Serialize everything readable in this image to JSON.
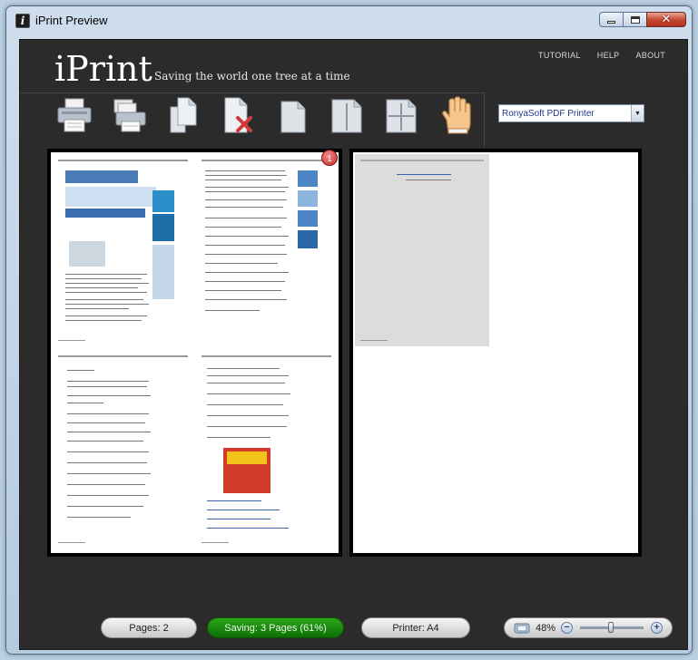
{
  "window": {
    "title": "iPrint Preview",
    "close_glyph": "✕"
  },
  "header": {
    "brand": "iPrint",
    "tagline": "Saving the world one tree at a time",
    "nav": [
      "TUTORIAL",
      "HELP",
      "ABOUT"
    ]
  },
  "toolbar": {
    "tools": [
      {
        "icon": "printer-icon"
      },
      {
        "icon": "print-multiple-icon"
      },
      {
        "icon": "copy-pages-icon"
      },
      {
        "icon": "delete-page-icon"
      },
      {
        "icon": "layout-single-icon"
      },
      {
        "icon": "layout-two-column-icon"
      },
      {
        "icon": "layout-four-up-icon"
      },
      {
        "icon": "hand-pan-icon"
      }
    ],
    "printer_select": {
      "selected": "RonyaSoft PDF Printer"
    }
  },
  "preview": {
    "page_badge": "1"
  },
  "status": {
    "pages": "Pages: 2",
    "saving": "Saving: 3 Pages (61%)",
    "printer": "Printer: A4",
    "zoom": "48%",
    "zoom_fraction": 0.48
  },
  "colors": {
    "client_bg": "#2b2b2b",
    "saving_green": "#1a8c10",
    "badge_red": "#c62b2b"
  }
}
